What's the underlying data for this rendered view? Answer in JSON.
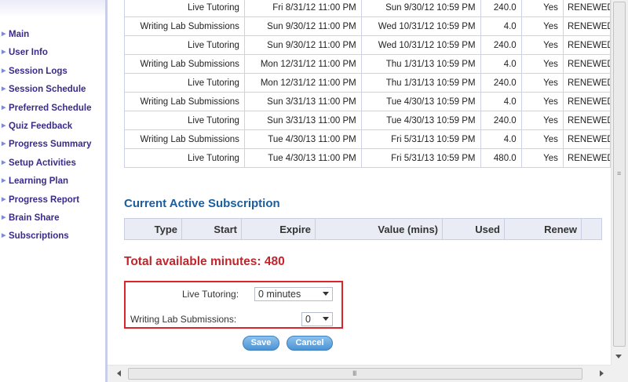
{
  "sidebar": {
    "items": [
      {
        "label": "Main"
      },
      {
        "label": "User Info"
      },
      {
        "label": "Session Logs"
      },
      {
        "label": "Session Schedule"
      },
      {
        "label": "Preferred Schedule"
      },
      {
        "label": "Quiz Feedback"
      },
      {
        "label": "Progress Summary"
      },
      {
        "label": "Setup Activities"
      },
      {
        "label": "Learning Plan"
      },
      {
        "label": "Progress Report"
      },
      {
        "label": "Brain Share"
      },
      {
        "label": "Subscriptions"
      }
    ]
  },
  "history": {
    "rows": [
      {
        "type": "Live Tutoring",
        "start": "Fri 8/31/12 11:00 PM",
        "expire": "Sun 9/30/12 10:59 PM",
        "value": "240.0",
        "renew": "Yes",
        "status": "RENEWED"
      },
      {
        "type": "Writing Lab Submissions",
        "start": "Sun 9/30/12 11:00 PM",
        "expire": "Wed 10/31/12 10:59 PM",
        "value": "4.0",
        "renew": "Yes",
        "status": "RENEWED"
      },
      {
        "type": "Live Tutoring",
        "start": "Sun 9/30/12 11:00 PM",
        "expire": "Wed 10/31/12 10:59 PM",
        "value": "240.0",
        "renew": "Yes",
        "status": "RENEWED"
      },
      {
        "type": "Writing Lab Submissions",
        "start": "Mon 12/31/12 11:00 PM",
        "expire": "Thu 1/31/13 10:59 PM",
        "value": "4.0",
        "renew": "Yes",
        "status": "RENEWED"
      },
      {
        "type": "Live Tutoring",
        "start": "Mon 12/31/12 11:00 PM",
        "expire": "Thu 1/31/13 10:59 PM",
        "value": "240.0",
        "renew": "Yes",
        "status": "RENEWED"
      },
      {
        "type": "Writing Lab Submissions",
        "start": "Sun 3/31/13 11:00 PM",
        "expire": "Tue 4/30/13 10:59 PM",
        "value": "4.0",
        "renew": "Yes",
        "status": "RENEWED"
      },
      {
        "type": "Live Tutoring",
        "start": "Sun 3/31/13 11:00 PM",
        "expire": "Tue 4/30/13 10:59 PM",
        "value": "240.0",
        "renew": "Yes",
        "status": "RENEWED"
      },
      {
        "type": "Writing Lab Submissions",
        "start": "Tue 4/30/13 11:00 PM",
        "expire": "Fri 5/31/13 10:59 PM",
        "value": "4.0",
        "renew": "Yes",
        "status": "RENEWED"
      },
      {
        "type": "Live Tutoring",
        "start": "Tue 4/30/13 11:00 PM",
        "expire": "Fri 5/31/13 10:59 PM",
        "value": "480.0",
        "renew": "Yes",
        "status": "RENEWED"
      }
    ]
  },
  "active": {
    "title": "Current Active Subscription",
    "headers": {
      "type": "Type",
      "start": "Start",
      "expire": "Expire",
      "value": "Value (mins)",
      "used": "Used",
      "renew": "Renew"
    }
  },
  "total": {
    "text": "Total available minutes: 480"
  },
  "allocation": {
    "live_label": "Live Tutoring:",
    "live_value": "0 minutes",
    "writing_label": "Writing Lab Submissions:",
    "writing_value": "0"
  },
  "buttons": {
    "save": "Save",
    "cancel": "Cancel"
  },
  "scrollbar": {
    "grip_v": "≡",
    "grip_h": "III"
  },
  "colors": {
    "accent": "#1b5e9e",
    "alert": "#c0262b",
    "nav": "#3b2a8a",
    "button": "#4c93d3"
  }
}
